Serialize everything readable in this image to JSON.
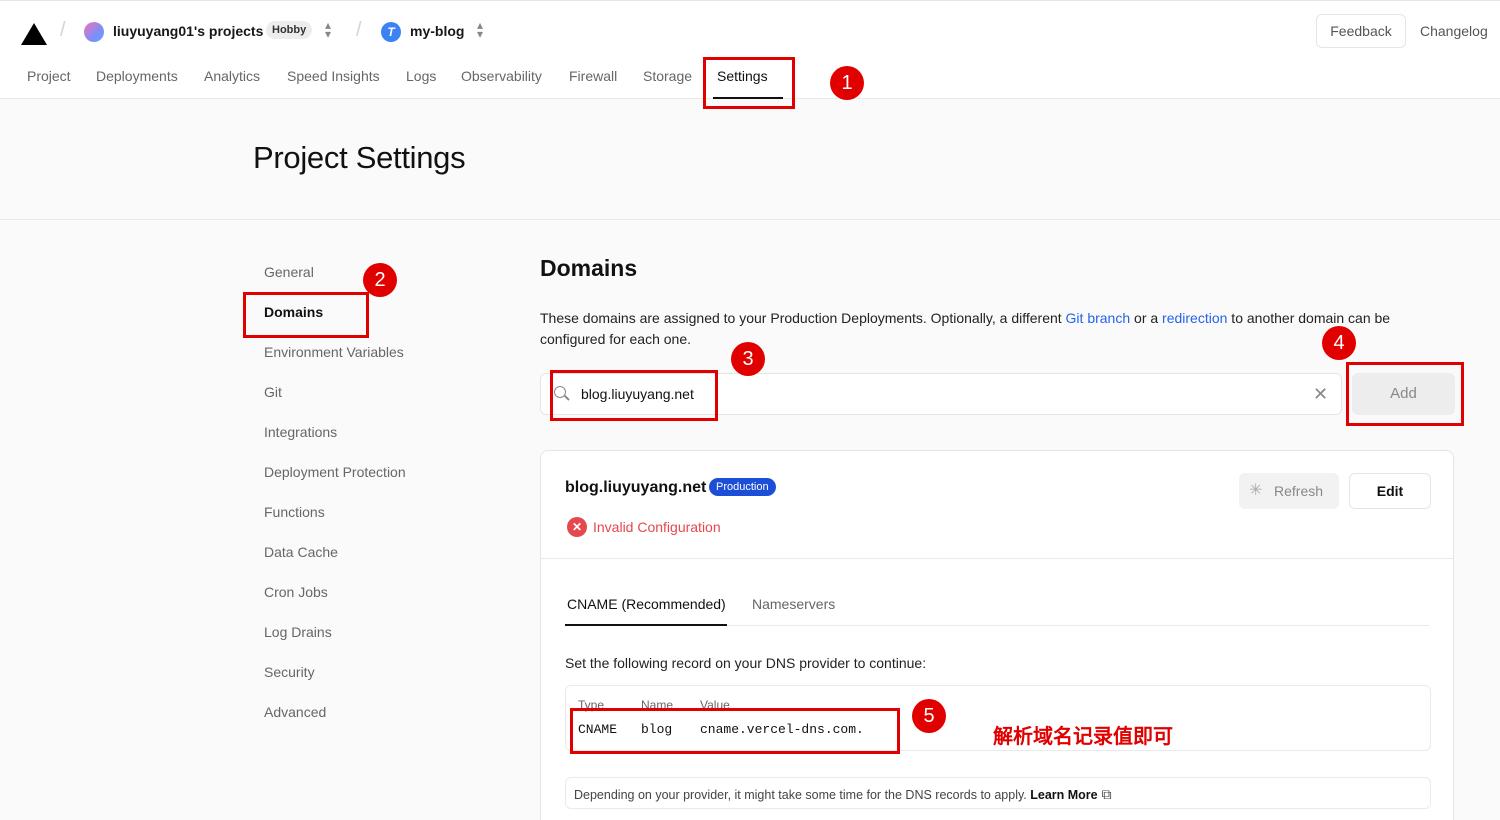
{
  "header": {
    "team": "liuyuyang01's projects",
    "plan_badge": "Hobby",
    "project": "my-blog",
    "project_icon_glyph": "T",
    "feedback": "Feedback",
    "changelog": "Changelog",
    "tabs": [
      "Project",
      "Deployments",
      "Analytics",
      "Speed Insights",
      "Logs",
      "Observability",
      "Firewall",
      "Storage",
      "Settings"
    ],
    "active_tab": "Settings"
  },
  "page_title": "Project Settings",
  "sidebar": {
    "items": [
      "General",
      "Domains",
      "Environment Variables",
      "Git",
      "Integrations",
      "Deployment Protection",
      "Functions",
      "Data Cache",
      "Cron Jobs",
      "Log Drains",
      "Security",
      "Advanced"
    ],
    "active": "Domains"
  },
  "domains": {
    "title": "Domains",
    "desc_part1": "These domains are assigned to your Production Deployments. Optionally, a different ",
    "link_git_branch": "Git branch",
    "desc_part2": " or a ",
    "link_redirection": "redirection",
    "desc_part3": " to another domain can be configured for each one.",
    "search_value": "blog.liuyuyang.net",
    "add_label": "Add",
    "card": {
      "domain": "blog.liuyuyang.net",
      "badge": "Production",
      "status": "Invalid Configuration",
      "refresh_label": "Refresh",
      "edit_label": "Edit",
      "tabs": [
        "CNAME (Recommended)",
        "Nameservers"
      ],
      "instruction": "Set the following record on your DNS provider to continue:",
      "record_headers": [
        "Type",
        "Name",
        "Value"
      ],
      "record_values": [
        "CNAME",
        "blog",
        "cname.vercel-dns.com."
      ],
      "note": "Depending on your provider, it might take some time for the DNS records to apply.",
      "learn_more": "Learn More"
    }
  },
  "annotations": {
    "numbers": [
      "1",
      "2",
      "3",
      "4",
      "5"
    ],
    "chinese_note": "解析域名记录值即可",
    "color": "#e10000"
  },
  "colors": {
    "accent_blue": "#2563eb",
    "error_red": "#e5484d",
    "production_badge": "#1d4ed8"
  }
}
